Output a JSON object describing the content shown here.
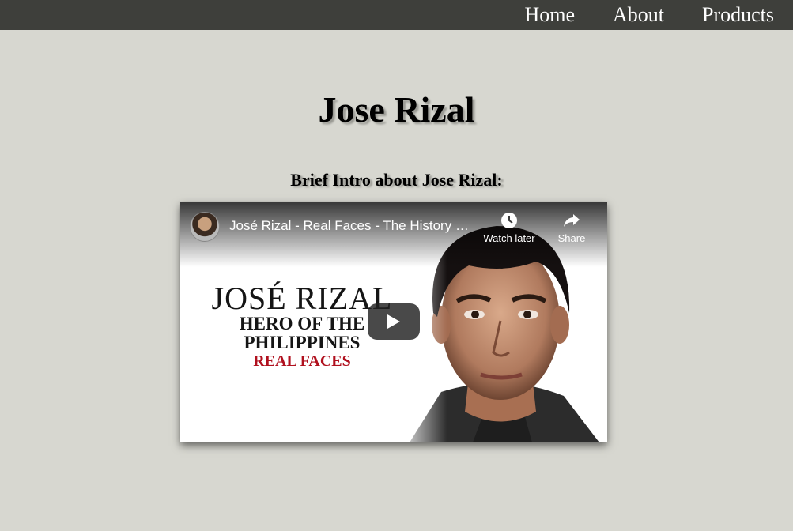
{
  "nav": {
    "items": [
      {
        "label": "Home"
      },
      {
        "label": "About"
      },
      {
        "label": "Products"
      }
    ]
  },
  "page": {
    "title": "Jose Rizal",
    "subtitle": "Brief Intro about Jose Rizal:"
  },
  "video": {
    "title": "José Rizal - Real Faces - The History of Philippines",
    "watch_later": "Watch later",
    "share": "Share",
    "poster": {
      "line1": "JOSÉ RIZAL",
      "line2": "HERO OF THE",
      "line3": "PHILIPPINES",
      "line4": "REAL FACES"
    },
    "icons": {
      "watch_later": "clock-icon",
      "share": "share-icon",
      "play": "play-icon"
    }
  },
  "colors": {
    "background": "#d7d7d0",
    "navbar": "#3e3f3b",
    "accent_red": "#b0101e"
  }
}
